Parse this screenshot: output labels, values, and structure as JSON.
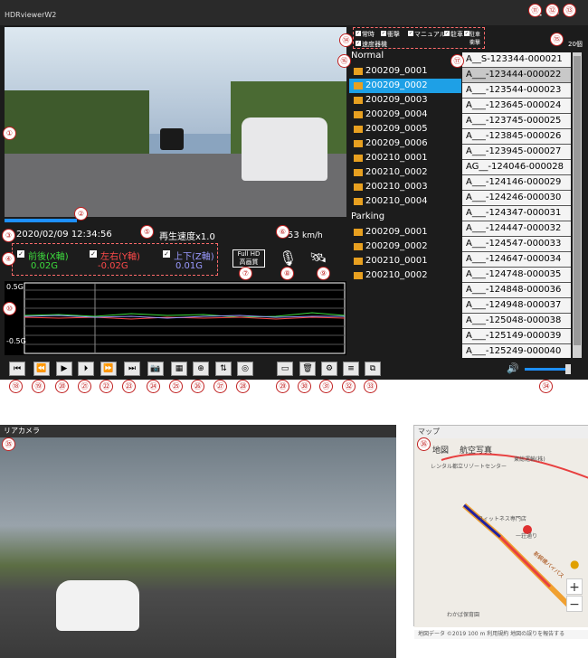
{
  "app": {
    "title": "HDRviewerW2"
  },
  "badges": [
    "①",
    "②",
    "③",
    "④",
    "⑤",
    "⑥",
    "⑦",
    "⑧",
    "⑨",
    "⑩",
    "⑪",
    "⑫",
    "⑬",
    "⑭",
    "⑮",
    "⑯",
    "⑰",
    "⑱",
    "⑲",
    "⑳",
    "㉑",
    "㉒",
    "㉓",
    "㉔",
    "㉕",
    "㉖",
    "㉗",
    "㉘",
    "㉙",
    "㉚",
    "㉛",
    "㉜",
    "㉝",
    "㉞",
    "㉟",
    "㊱"
  ],
  "status": {
    "datetime": "2020/02/09 12:34:56",
    "speed_label": "再生速度x1.0",
    "vehicle_speed": "53",
    "speed_unit": "km/h"
  },
  "gsensor": {
    "x_label": "前後(X軸)",
    "x_value": "0.02G",
    "y_label": "左右(Y軸)",
    "y_value": "-0.02G",
    "z_label": "上下(Z軸)",
    "z_value": "0.01G",
    "x_color": "#3ddc3d",
    "y_color": "#ff4a4a",
    "z_color": "#9a9aff"
  },
  "quality": {
    "line1": "Full HD",
    "line2": "高画質"
  },
  "graph": {
    "top_label": "0.5G",
    "bottom_label": "-0.5G"
  },
  "filters": [
    "常時",
    "衝撃",
    "マニュアル",
    "駐車",
    "駐車衝撃",
    "速度器機"
  ],
  "file_count": "20個",
  "groups": {
    "normal_label": "Normal",
    "normal": [
      "200209_0001",
      "200209_0002",
      "200209_0003",
      "200209_0004",
      "200209_0005",
      "200209_0006",
      "200210_0001",
      "200210_0002",
      "200210_0003",
      "200210_0004"
    ],
    "parking_label": "Parking",
    "parking": [
      "200209_0001",
      "200209_0002",
      "200210_0001",
      "200210_0002"
    ]
  },
  "ids": [
    "A__S-123344-000021",
    "A___-123444-000022",
    "A___-123544-000023",
    "A___-123645-000024",
    "A___-123745-000025",
    "A___-123845-000026",
    "A___-123945-000027",
    "AG__-124046-000028",
    "A___-124146-000029",
    "A___-124246-000030",
    "A___-124347-000031",
    "A___-124447-000032",
    "A___-124547-000033",
    "A___-124647-000034",
    "A___-124748-000035",
    "A___-124848-000036",
    "A___-124948-000037",
    "A___-125048-000038",
    "A___-125149-000039",
    "A___-125249-000040"
  ],
  "toolbar_icons": [
    "skip-start-icon",
    "rewind-icon",
    "play-icon",
    "step-forward-icon",
    "fast-forward-icon",
    "skip-end-icon",
    "camera-icon",
    "photo-icon",
    "zoom-icon",
    "flip-icon",
    "globe-icon",
    "folder-icon",
    "trash-icon",
    "gear-icon",
    "csv-icon",
    "window-icon"
  ],
  "toolbar_glyphs": [
    "⏮",
    "⏪",
    "▶",
    "⏵",
    "⏩",
    "⏭",
    "📷",
    "▦",
    "⊕",
    "⇅",
    "◎",
    "▭",
    "🗑",
    "⚙",
    "≡",
    "⧉"
  ],
  "volume": {
    "level": 0.9,
    "glyph": "🔊"
  },
  "sub_camera": {
    "title": "リアカメラ"
  },
  "map": {
    "title": "マップ",
    "tab_map": "地図",
    "tab_photo": "航空写真",
    "poi1": "レンタル都立リゾートセンター",
    "poi2": "東総運輸(株)",
    "poi3": "フィットネス専門店",
    "poi4": "わかば保育園",
    "poi5": "一荘通り",
    "road": "新鋼橋バイパス",
    "footer": "地図データ ©2019   100 m   利用規約   地図の誤りを報告する",
    "zoom_in": "+",
    "zoom_out": "−"
  }
}
